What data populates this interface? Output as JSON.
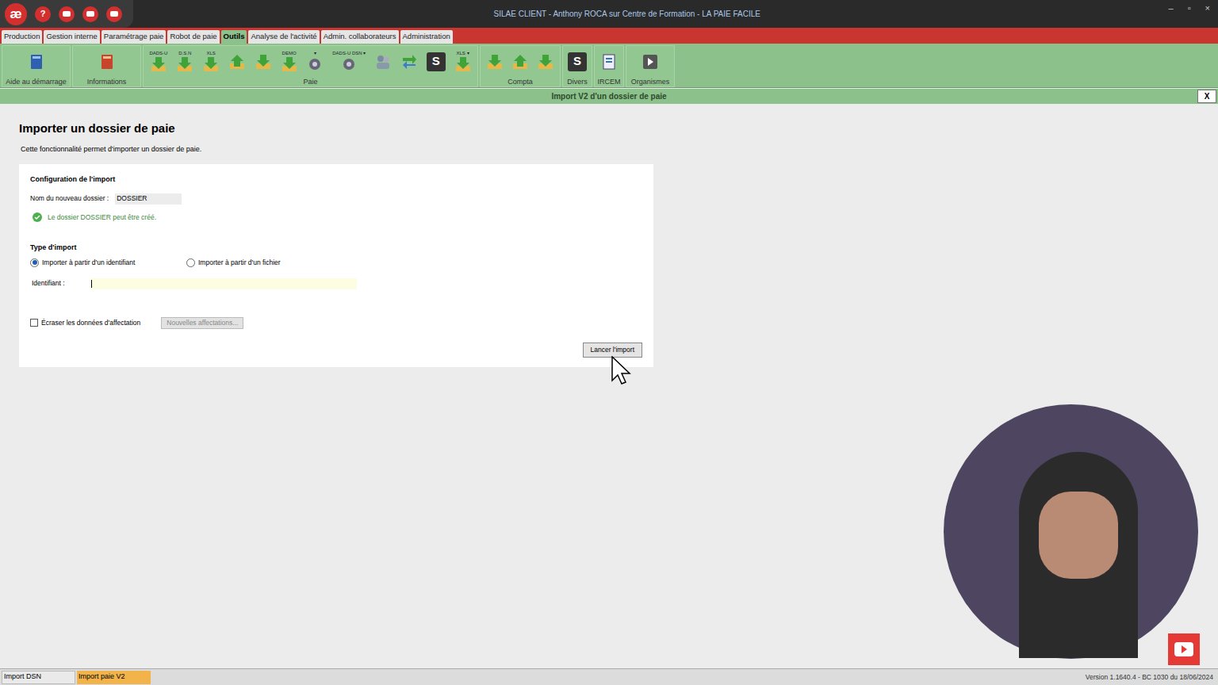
{
  "window": {
    "logo": "æ",
    "help": "?",
    "title": "SILAE CLIENT - Anthony ROCA sur Centre de Formation - LA PAIE FACILE",
    "controls": [
      "–",
      "▫",
      "×"
    ]
  },
  "tabs": [
    {
      "label": "Production",
      "selected": false
    },
    {
      "label": "Gestion interne",
      "selected": false
    },
    {
      "label": "Paramétrage paie",
      "selected": false
    },
    {
      "label": "Robot de paie",
      "selected": false
    },
    {
      "label": "Outils",
      "selected": true
    },
    {
      "label": "Analyse de l'activité",
      "selected": false
    },
    {
      "label": "Admin. collaborateurs",
      "selected": false
    },
    {
      "label": "Administration",
      "selected": false
    }
  ],
  "ribbon": [
    {
      "label": "Aide au démarrage",
      "items": [
        {
          "kind": "book-blue",
          "caption": ""
        }
      ]
    },
    {
      "label": "Informations",
      "items": [
        {
          "kind": "book-red",
          "caption": ""
        }
      ]
    },
    {
      "label": "Paie",
      "items": [
        {
          "kind": "arrow-down",
          "caption": "DADS-U"
        },
        {
          "kind": "arrow-down",
          "caption": "D.S.N"
        },
        {
          "kind": "arrow-down",
          "caption": "XLS"
        },
        {
          "kind": "arrow-up",
          "caption": ""
        },
        {
          "kind": "arrow-down",
          "caption": ""
        },
        {
          "kind": "arrow-down",
          "caption": "DEMO"
        },
        {
          "kind": "gear",
          "caption": "▾"
        },
        {
          "kind": "gear",
          "caption": "DADS-U DSN ▾"
        },
        {
          "kind": "people",
          "caption": ""
        },
        {
          "kind": "swap",
          "caption": ""
        },
        {
          "kind": "s-logo",
          "caption": "S"
        },
        {
          "kind": "arrow-down",
          "caption": "XLS ▾"
        }
      ]
    },
    {
      "label": "Compta",
      "items": [
        {
          "kind": "arrow-down",
          "caption": ""
        },
        {
          "kind": "arrow-up",
          "caption": ""
        },
        {
          "kind": "arrow-down",
          "caption": ""
        }
      ]
    },
    {
      "label": "Divers",
      "items": [
        {
          "kind": "s-logo",
          "caption": "S"
        }
      ]
    },
    {
      "label": "IRCEM",
      "items": [
        {
          "kind": "doc",
          "caption": ""
        }
      ]
    },
    {
      "label": "Organismes",
      "items": [
        {
          "kind": "next",
          "caption": ""
        }
      ]
    }
  ],
  "panel": {
    "title": "Import V2 d'un dossier de paie",
    "close": "X"
  },
  "page": {
    "heading": "Importer un dossier de paie",
    "description": "Cette fonctionnalité permet d'importer un dossier de paie."
  },
  "form": {
    "section": "Configuration de l'import",
    "name_label": "Nom du nouveau dossier :",
    "name_value": "DOSSIER",
    "validation": "Le dossier DOSSIER peut être créé.",
    "type_label": "Type d'import",
    "radios": [
      {
        "label": "Importer à partir d'un identifiant",
        "selected": true
      },
      {
        "label": "Importer à partir d'un fichier",
        "selected": false
      }
    ],
    "id_label": "Identifiant :",
    "id_value": "",
    "overwrite": {
      "label": "Écraser les données d'affectation",
      "checked": false
    },
    "affect_button": {
      "label": "Nouvelles affectations...",
      "disabled": true
    },
    "submit": "Lancer l'import"
  },
  "status_bar": {
    "tabs": [
      {
        "label": "Import DSN",
        "selected": false
      },
      {
        "label": "Import paie V2",
        "selected": true
      }
    ],
    "version": "Version 1.1640.4 - BC 1030 du 18/06/2024"
  }
}
